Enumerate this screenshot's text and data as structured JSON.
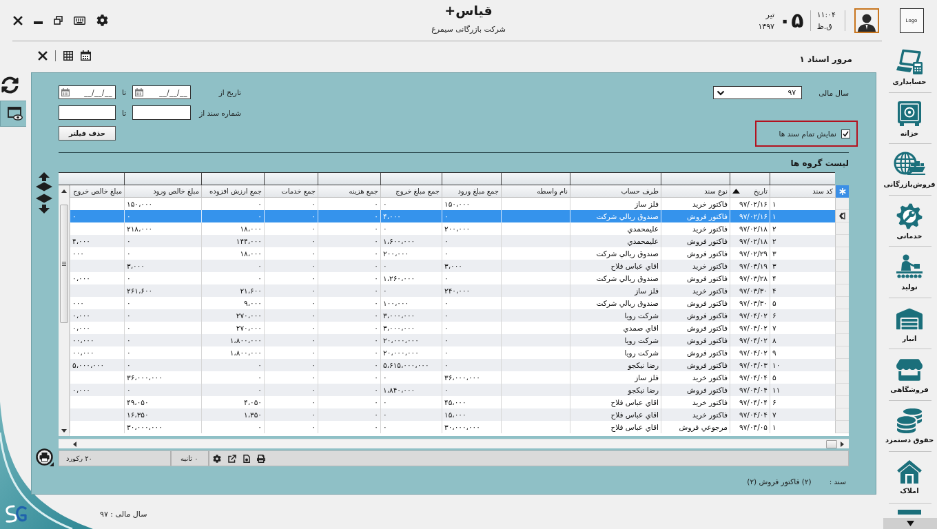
{
  "header": {
    "logo": "Logo",
    "title": "قیاس+",
    "subtitle": "شرکت بازرگانی سیمرغ",
    "date": {
      "day": "۰۵",
      "month": "تیر",
      "year": "۱۳۹۷"
    },
    "clock": {
      "time": "۱۱:۰۴",
      "period": "ق.ظ"
    }
  },
  "toolbar": {
    "title": "مرور اسناد ۱"
  },
  "left_rail": {
    "items": [
      {
        "kind": "refresh",
        "selected": false
      },
      {
        "kind": "view",
        "selected": true
      }
    ]
  },
  "sidebar": {
    "items": [
      {
        "kind": "accounting",
        "label": "حسابداری"
      },
      {
        "kind": "treasury",
        "label": "خزانه"
      },
      {
        "kind": "trade",
        "label": "فروش‌بازرگانی"
      },
      {
        "kind": "services",
        "label": "خدماتی"
      },
      {
        "kind": "production",
        "label": "تولید"
      },
      {
        "kind": "warehouse",
        "label": "انبار"
      },
      {
        "kind": "store",
        "label": "فروشگاهی"
      },
      {
        "kind": "payroll",
        "label": "حقوق دستمزد"
      },
      {
        "kind": "property",
        "label": "املاک"
      }
    ]
  },
  "filters": {
    "fiscal_year": {
      "label": "سال مالی",
      "value": "۹۷"
    },
    "show_all": {
      "label": "نمایش تمام سند ها",
      "checked": true
    },
    "date_from": {
      "label": "تاریخ از",
      "value": "__/__/__"
    },
    "date_to": {
      "label": "تا",
      "value": "__/__/__"
    },
    "number_from": {
      "label": "شماره سند از"
    },
    "number_to": {
      "label": "تا"
    },
    "clear_button": "حذف فیلتر"
  },
  "table": {
    "title": "لیست گروه ها",
    "columns": [
      {
        "label": "کد سند"
      },
      {
        "label": "تاریخ",
        "sorted": true
      },
      {
        "label": "نوع سند"
      },
      {
        "label": "طرف حساب"
      },
      {
        "label": "نام واسطه"
      },
      {
        "label": "جمع مبلغ ورود"
      },
      {
        "label": "جمع مبلغ خروج"
      },
      {
        "label": "جمع هزینه"
      },
      {
        "label": "جمع خدمات"
      },
      {
        "label": "جمع ارزش افزوده"
      },
      {
        "label": "مبلغ خالص ورود"
      },
      {
        "label": "مبلغ خالص خروج"
      }
    ],
    "rows": [
      {
        "selected": false,
        "cells": [
          "۱",
          "۹۷/۰۲/۱۶",
          "فاکتور خرید",
          "فلز ساز",
          null,
          "۱۵۰،۰۰۰",
          "۰",
          "۰",
          "۰",
          "۰",
          "۱۵۰،۰۰۰",
          null
        ]
      },
      {
        "selected": true,
        "cells": [
          "۱",
          "۹۷/۰۲/۱۶",
          "فاکتور فروش",
          "صندوق ریالي شرکت",
          null,
          "۰",
          "۴،۰۰۰",
          "۰",
          "۰",
          "۰",
          "۰",
          "۰"
        ]
      },
      {
        "selected": false,
        "cells": [
          "۲",
          "۹۷/۰۲/۱۸",
          "فاکتور خرید",
          "علیمحمدي",
          null,
          "۲۰۰،۰۰۰",
          "۰",
          "۰",
          "۰",
          "۱۸،۰۰۰",
          "۲۱۸،۰۰۰",
          null
        ]
      },
      {
        "selected": false,
        "cells": [
          "۲",
          "۹۷/۰۲/۱۸",
          "فاکتور فروش",
          "علیمحمدي",
          null,
          "۰",
          "۱،۶۰۰،۰۰۰",
          "۰",
          "۰",
          "۱۴۴،۰۰۰",
          "۰",
          "۴،۰۰۰"
        ]
      },
      {
        "selected": false,
        "cells": [
          "۳",
          "۹۷/۰۲/۲۹",
          "فاکتور فروش",
          "صندوق ریالي شرکت",
          null,
          "۰",
          "۲۰۰،۰۰۰",
          "۰",
          "۰",
          "۱۸،۰۰۰",
          "۰",
          "۰۰۰"
        ]
      },
      {
        "selected": false,
        "cells": [
          "۳",
          "۹۷/۰۳/۱۹",
          "فاکتور خرید",
          "اقاي عباس فلاح",
          null,
          "۳،۰۰۰",
          "۰",
          "۰",
          "۰",
          "۰",
          "۳،۰۰۰",
          null
        ]
      },
      {
        "selected": false,
        "cells": [
          "۴",
          "۹۷/۰۳/۲۸",
          "فاکتور فروش",
          "صندوق ریالي شرکت",
          null,
          "۰",
          "۱،۲۶۰،۰۰۰",
          "۰",
          "۰",
          "۰",
          "۰",
          "۰،۰۰۰"
        ]
      },
      {
        "selected": false,
        "cells": [
          "۴",
          "۹۷/۰۳/۳۰",
          "فاکتور خرید",
          "فلز ساز",
          null,
          "۲۴۰،۰۰۰",
          "۰",
          "۰",
          "۰",
          "۲۱،۶۰۰",
          "۲۶۱،۶۰۰",
          null
        ]
      },
      {
        "selected": false,
        "cells": [
          "۵",
          "۹۷/۰۳/۳۰",
          "فاکتور فروش",
          "صندوق ریالي شرکت",
          null,
          "۰",
          "۱۰۰،۰۰۰",
          "۰",
          "۰",
          "۹،۰۰۰",
          "۰",
          "۰۰۰"
        ]
      },
      {
        "selected": false,
        "cells": [
          "۶",
          "۹۷/۰۴/۰۲",
          "فاکتور فروش",
          "شرکت رویا",
          null,
          "۰",
          "۳،۰۰۰،۰۰۰",
          "۰",
          "۰",
          "۲۷۰،۰۰۰",
          "۰",
          "۰،۰۰۰"
        ]
      },
      {
        "selected": false,
        "cells": [
          "۷",
          "۹۷/۰۴/۰۲",
          "فاکتور فروش",
          "اقاي صمدي",
          null,
          "۰",
          "۳،۰۰۰،۰۰۰",
          "۰",
          "۰",
          "۲۷۰،۰۰۰",
          "۰",
          "۰،۰۰۰"
        ]
      },
      {
        "selected": false,
        "cells": [
          "۸",
          "۹۷/۰۴/۰۲",
          "فاکتور فروش",
          "شرکت رویا",
          null,
          "۰",
          "۲۰،۰۰۰،۰۰۰",
          "۰",
          "۰",
          "۱،۸۰۰،۰۰۰",
          "۰",
          "۰۰،۰۰۰"
        ]
      },
      {
        "selected": false,
        "cells": [
          "۹",
          "۹۷/۰۴/۰۲",
          "فاکتور فروش",
          "شرکت رویا",
          null,
          "۰",
          "۲۰،۰۰۰،۰۰۰",
          "۰",
          "۰",
          "۱،۸۰۰،۰۰۰",
          "۰",
          "۰۰،۰۰۰"
        ]
      },
      {
        "selected": false,
        "cells": [
          "۱۰",
          "۹۷/۰۴/۰۳",
          "فاکتور فروش",
          "رضا نیکجو",
          null,
          "۰",
          "۵،۶۱۵،۰۰۰،۰۰۰",
          "۰",
          "۰",
          "۰",
          "۰",
          "۵،۰۰۰،۰۰۰"
        ]
      },
      {
        "selected": false,
        "cells": [
          "۵",
          "۹۷/۰۴/۰۴",
          "فاکتور خرید",
          "فلز ساز",
          null,
          "۳۶،۰۰۰،۰۰۰",
          "۰",
          "۰",
          "۰",
          "۰",
          "۳۶،۰۰۰،۰۰۰",
          null
        ]
      },
      {
        "selected": false,
        "cells": [
          "۱۱",
          "۹۷/۰۴/۰۴",
          "فاکتور فروش",
          "رضا نیکجو",
          null,
          "۰",
          "۱،۸۴۰،۰۰۰",
          "۰",
          "۰",
          "۰",
          "۰",
          "۰،۰۰۰"
        ]
      },
      {
        "selected": false,
        "cells": [
          "۶",
          "۹۷/۰۴/۰۴",
          "فاکتور خرید",
          "اقاي عباس فلاح",
          null,
          "۴۵،۰۰۰",
          "۰",
          "۰",
          "۰",
          "۴،۰۵۰",
          "۴۹،۰۵۰",
          null
        ]
      },
      {
        "selected": false,
        "cells": [
          "۷",
          "۹۷/۰۴/۰۴",
          "فاکتور خرید",
          "اقاي عباس فلاح",
          null,
          "۱۵،۰۰۰",
          "۰",
          "۰",
          "۰",
          "۱،۳۵۰",
          "۱۶،۳۵۰",
          null
        ]
      },
      {
        "selected": false,
        "cells": [
          "۱",
          "۹۷/۰۴/۰۵",
          "مرجوعي فروش",
          "اقاي عباس فلاح",
          null,
          "۳۰،۰۰۰،۰۰۰",
          "۰",
          "۰",
          "۰",
          "۰",
          "۳۰،۰۰۰،۰۰۰",
          null
        ]
      }
    ],
    "footer": {
      "records": "۲۰ رکورد",
      "elapsed": "۰ ثانیه"
    }
  },
  "document": {
    "label": "سند :",
    "value": "(۲) فاکتور فروش (۲)"
  },
  "status_bar": {
    "fiscal_year": "سال مالی : ۹۷"
  }
}
